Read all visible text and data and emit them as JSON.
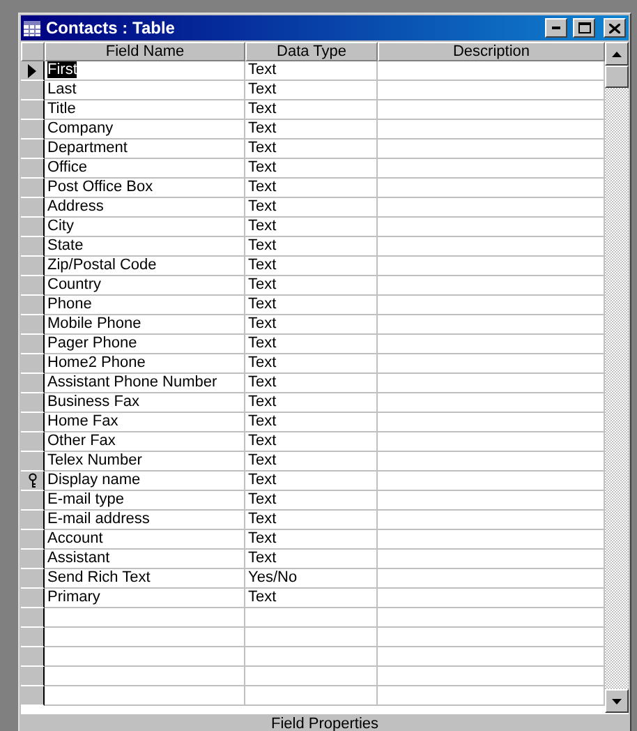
{
  "window": {
    "title": "Contacts : Table"
  },
  "table": {
    "columns": [
      "Field Name",
      "Data Type",
      "Description"
    ],
    "rows": [
      {
        "field_name": "First",
        "data_type": "Text",
        "current": true,
        "selected": true,
        "key": false
      },
      {
        "field_name": "Last",
        "data_type": "Text",
        "current": false,
        "selected": false,
        "key": false
      },
      {
        "field_name": "Title",
        "data_type": "Text",
        "current": false,
        "selected": false,
        "key": false
      },
      {
        "field_name": "Company",
        "data_type": "Text",
        "current": false,
        "selected": false,
        "key": false
      },
      {
        "field_name": "Department",
        "data_type": "Text",
        "current": false,
        "selected": false,
        "key": false
      },
      {
        "field_name": "Office",
        "data_type": "Text",
        "current": false,
        "selected": false,
        "key": false
      },
      {
        "field_name": "Post Office Box",
        "data_type": "Text",
        "current": false,
        "selected": false,
        "key": false
      },
      {
        "field_name": "Address",
        "data_type": "Text",
        "current": false,
        "selected": false,
        "key": false
      },
      {
        "field_name": "City",
        "data_type": "Text",
        "current": false,
        "selected": false,
        "key": false
      },
      {
        "field_name": "State",
        "data_type": "Text",
        "current": false,
        "selected": false,
        "key": false
      },
      {
        "field_name": "Zip/Postal Code",
        "data_type": "Text",
        "current": false,
        "selected": false,
        "key": false
      },
      {
        "field_name": "Country",
        "data_type": "Text",
        "current": false,
        "selected": false,
        "key": false
      },
      {
        "field_name": "Phone",
        "data_type": "Text",
        "current": false,
        "selected": false,
        "key": false
      },
      {
        "field_name": "Mobile Phone",
        "data_type": "Text",
        "current": false,
        "selected": false,
        "key": false
      },
      {
        "field_name": "Pager Phone",
        "data_type": "Text",
        "current": false,
        "selected": false,
        "key": false
      },
      {
        "field_name": "Home2 Phone",
        "data_type": "Text",
        "current": false,
        "selected": false,
        "key": false
      },
      {
        "field_name": "Assistant Phone Number",
        "data_type": "Text",
        "current": false,
        "selected": false,
        "key": false
      },
      {
        "field_name": "Business Fax",
        "data_type": "Text",
        "current": false,
        "selected": false,
        "key": false
      },
      {
        "field_name": "Home Fax",
        "data_type": "Text",
        "current": false,
        "selected": false,
        "key": false
      },
      {
        "field_name": "Other Fax",
        "data_type": "Text",
        "current": false,
        "selected": false,
        "key": false
      },
      {
        "field_name": "Telex Number",
        "data_type": "Text",
        "current": false,
        "selected": false,
        "key": false
      },
      {
        "field_name": "Display name",
        "data_type": "Text",
        "current": false,
        "selected": false,
        "key": true
      },
      {
        "field_name": "E-mail type",
        "data_type": "Text",
        "current": false,
        "selected": false,
        "key": false
      },
      {
        "field_name": "E-mail address",
        "data_type": "Text",
        "current": false,
        "selected": false,
        "key": false
      },
      {
        "field_name": "Account",
        "data_type": "Text",
        "current": false,
        "selected": false,
        "key": false
      },
      {
        "field_name": "Assistant",
        "data_type": "Text",
        "current": false,
        "selected": false,
        "key": false
      },
      {
        "field_name": "Send Rich Text",
        "data_type": "Yes/No",
        "current": false,
        "selected": false,
        "key": false
      },
      {
        "field_name": "Primary",
        "data_type": "Text",
        "current": false,
        "selected": false,
        "key": false
      }
    ]
  },
  "field_properties": {
    "title": "Field Properties"
  }
}
